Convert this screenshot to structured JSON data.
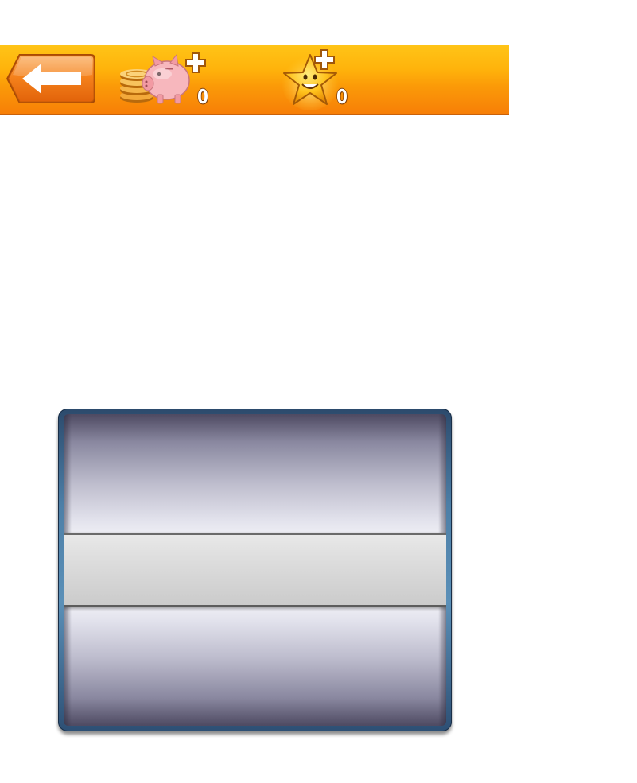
{
  "toolbar": {
    "back_icon": "left-arrow-icon",
    "coins": {
      "icon": "piggy-bank-icon",
      "value": "0"
    },
    "stars": {
      "icon": "star-icon",
      "value": "0"
    },
    "colors": {
      "bar_top": "#ffc417",
      "bar_bottom": "#f77f07",
      "back_button": "#f47a10",
      "back_arrow": "#ffffff"
    }
  },
  "picker": {
    "frame_color": "#4d7fa7",
    "selection_color": "#dcdcdc"
  }
}
